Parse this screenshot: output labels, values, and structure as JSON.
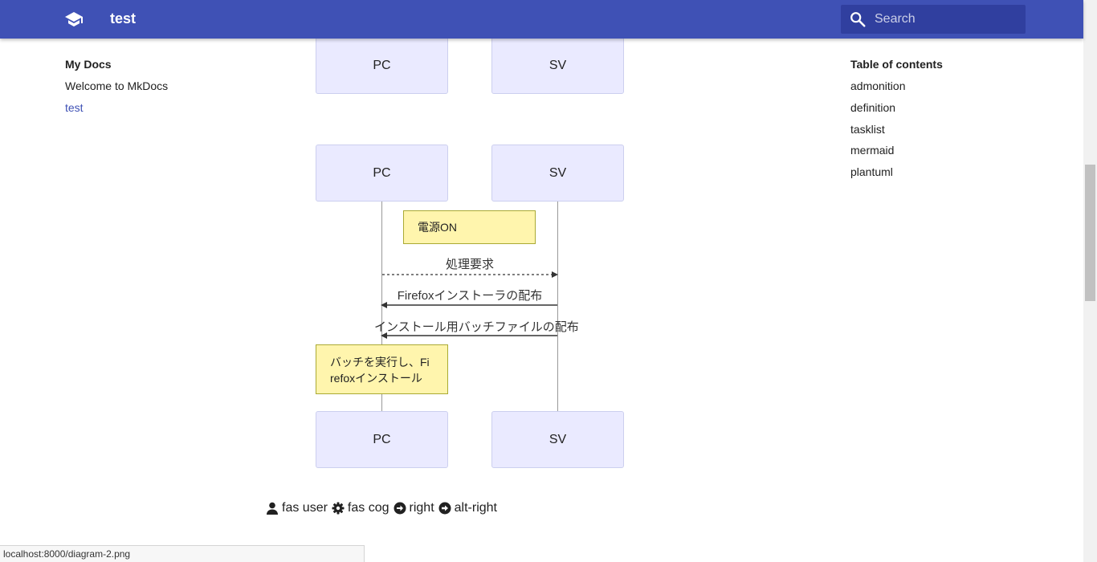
{
  "header": {
    "site_title": "test",
    "search_placeholder": "Search"
  },
  "nav": {
    "title": "My Docs",
    "items": [
      {
        "label": "Welcome to MkDocs"
      },
      {
        "label": "test"
      }
    ]
  },
  "toc": {
    "title": "Table of contents",
    "items": [
      {
        "label": "admonition"
      },
      {
        "label": "definition"
      },
      {
        "label": "tasklist"
      },
      {
        "label": "mermaid"
      },
      {
        "label": "plantuml"
      }
    ]
  },
  "diagram": {
    "top_partial": {
      "participant_a": "PC",
      "participant_b": "SV"
    },
    "participants": {
      "a": "PC",
      "b": "SV"
    },
    "note_power": "電源ON",
    "messages": [
      {
        "text": "処理要求"
      },
      {
        "text": "Firefoxインストーラの配布"
      },
      {
        "text": "インストール用バッチファイルの配布"
      }
    ],
    "note_batch_line1": "バッチを実行し、Fi",
    "note_batch_line2": "refoxインストール",
    "bottom": {
      "participant_a": "PC",
      "participant_b": "SV"
    }
  },
  "icon_line": {
    "user_label": "fas user",
    "cog_label": "fas cog",
    "right_label": "right",
    "alt_right_label": "alt-right"
  },
  "status_bar": {
    "url": "localhost:8000/diagram-2.png"
  }
}
